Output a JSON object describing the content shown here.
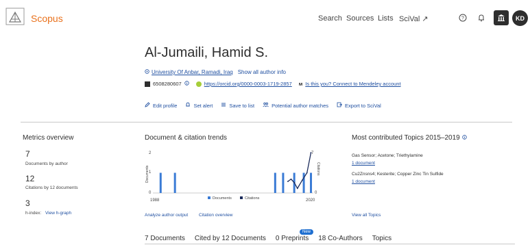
{
  "header": {
    "brand": "Scopus",
    "nav": [
      "Search",
      "Sources",
      "Lists",
      "SciVal ↗"
    ],
    "avatar": "KD"
  },
  "author": {
    "name": "Al-Jumaili, Hamid S.",
    "affiliation": "University Of Anbar, Ramadi, Iraq",
    "show_all": "Show all author info",
    "scopus_id": "6508280607",
    "orcid": "https://orcid.org/0000-0003-1719-2857",
    "mendeley": "Is this you? Connect to Mendeley account"
  },
  "actions": [
    "Edit profile",
    "Set alert",
    "Save to list",
    "Potential author matches",
    "Export to SciVal"
  ],
  "metrics": {
    "title": "Metrics overview",
    "documents_value": "7",
    "documents_label": "Documents by author",
    "citations_value": "12",
    "citations_label": "Citations by 12 documents",
    "hindex_value": "3",
    "hindex_label": "h-index:",
    "hgraph_link": "View h-graph"
  },
  "trends": {
    "title": "Document & citation trends",
    "analyze_link": "Analyze author output",
    "citation_link": "Citation overview"
  },
  "chart_data": {
    "type": "bar",
    "title": "",
    "x_start_label": "1988",
    "x_end_label": "2020",
    "ylabel_left": "Documents",
    "ylabel_right": "Citations",
    "y_left_ticks": [
      "2",
      "1",
      "0"
    ],
    "y_right_ticks": [
      "7",
      "0"
    ],
    "documents_bars": [
      {
        "pos": 0.04,
        "value": 1
      },
      {
        "pos": 0.13,
        "value": 1
      },
      {
        "pos": 0.76,
        "value": 1
      },
      {
        "pos": 0.81,
        "value": 1
      },
      {
        "pos": 0.88,
        "value": 1
      },
      {
        "pos": 0.94,
        "value": 1
      },
      {
        "pos": 0.985,
        "value": 1
      }
    ],
    "citations_line": [
      {
        "pos": 0.84,
        "value": 2
      },
      {
        "pos": 0.86,
        "value": 2.4
      },
      {
        "pos": 0.88,
        "value": 1.8
      },
      {
        "pos": 0.9,
        "value": 0.8
      },
      {
        "pos": 0.93,
        "value": 2.2
      },
      {
        "pos": 0.96,
        "value": 3.5
      },
      {
        "pos": 0.985,
        "value": 7
      }
    ],
    "y_left_max": 2,
    "y_right_max": 7,
    "legend": [
      "Documents",
      "Citations"
    ],
    "colors": {
      "documents": "#3a7bd5",
      "citations": "#1a2a5a"
    }
  },
  "topics": {
    "title": "Most contributed Topics 2015–2019",
    "items": [
      {
        "name": "Gas Sensor; Acetone; Triethylamine",
        "docs": "1 document"
      },
      {
        "name": "Cu2Znsns4; Kesterite; Copper Zinc Tin Sulfide",
        "docs": "1 document"
      }
    ],
    "view_all": "View all Topics"
  },
  "tabs": {
    "items": [
      "7 Documents",
      "Cited by 12 Documents",
      "0 Preprints",
      "18 Co-Authors",
      "Topics"
    ],
    "badge": "New"
  }
}
